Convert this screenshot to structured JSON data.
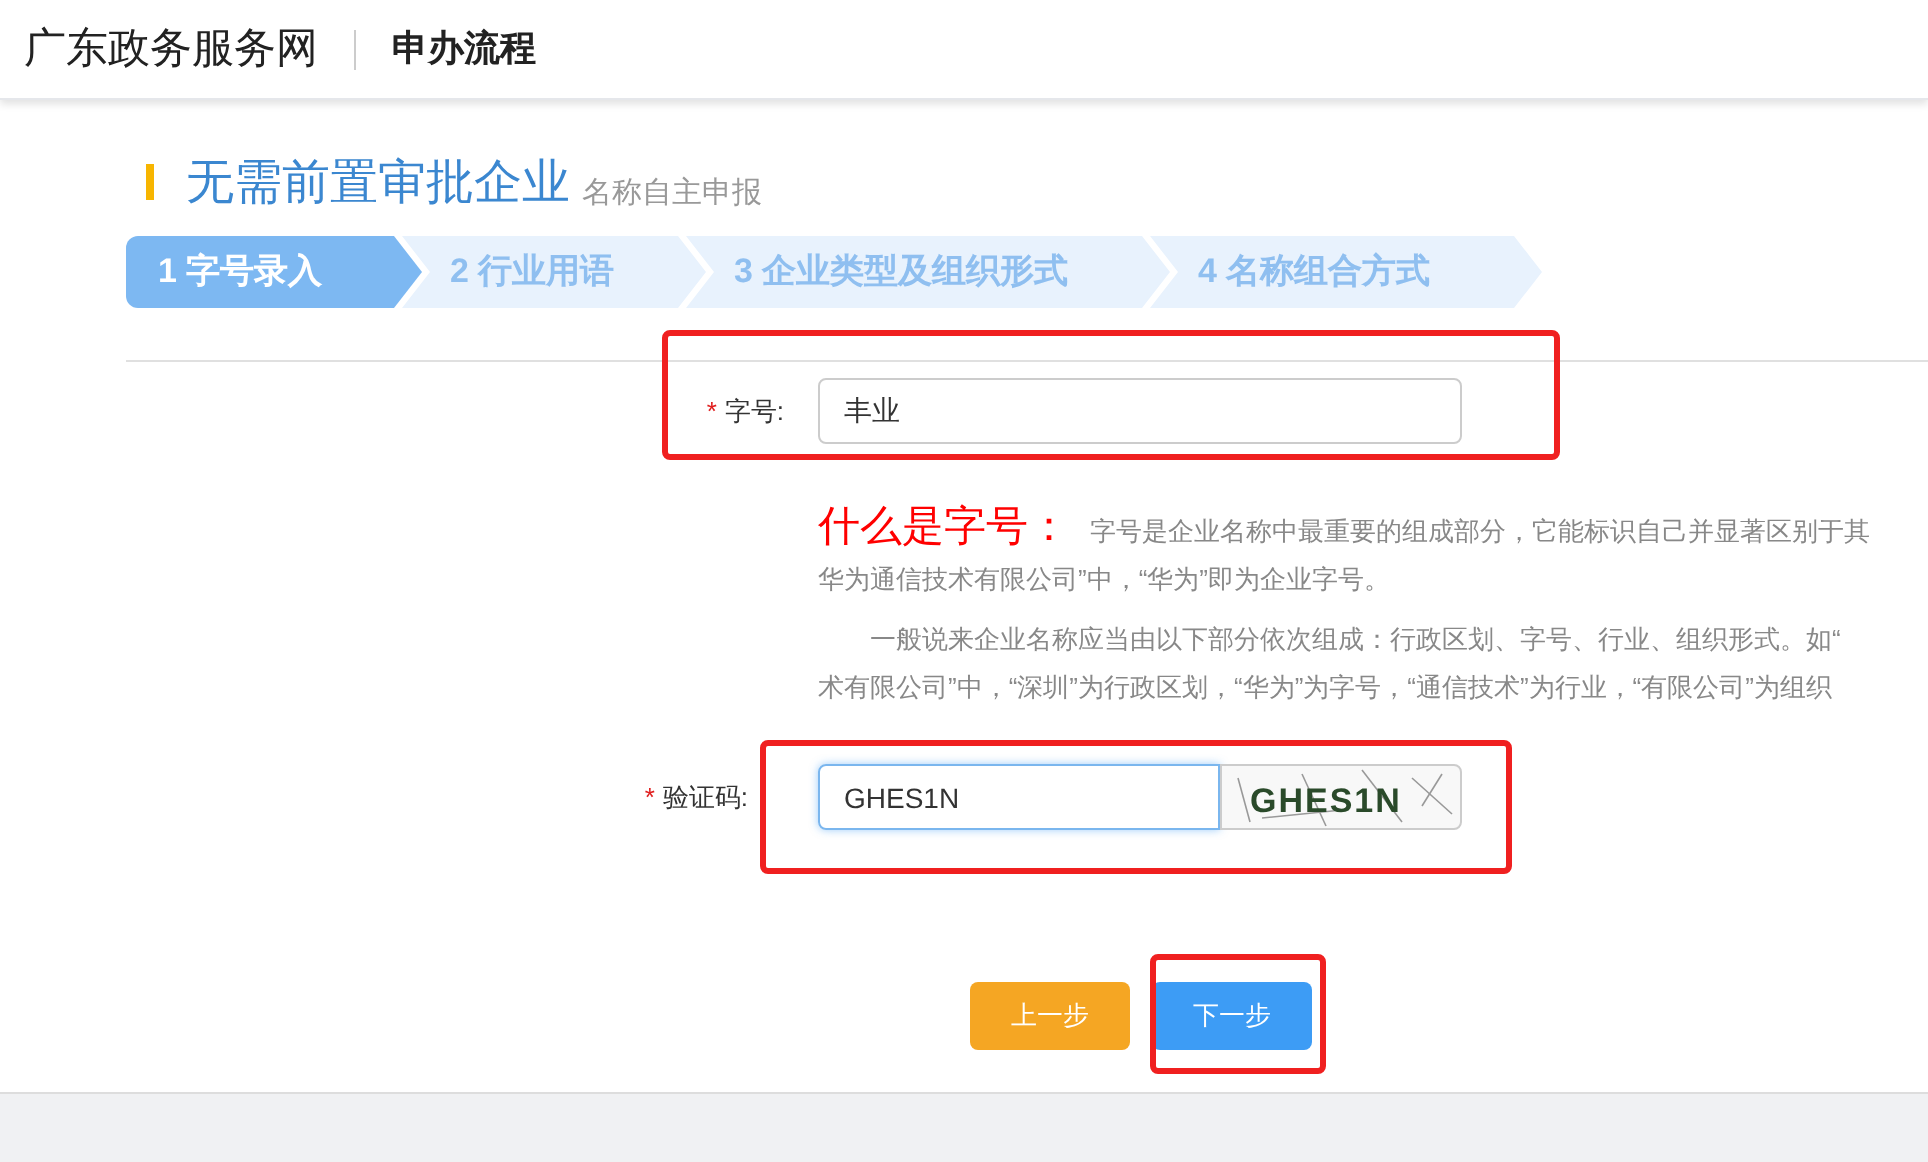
{
  "header": {
    "site_title": "广东政务服务网",
    "section": "申办流程"
  },
  "page_title": {
    "main": "无需前置审批企业",
    "sub": "名称自主申报"
  },
  "steps": [
    {
      "label": "1 字号录入",
      "selected": true
    },
    {
      "label": "2 行业用语",
      "selected": false
    },
    {
      "label": "3 企业类型及组织形式",
      "selected": false
    },
    {
      "label": "4 名称组合方式",
      "selected": false
    }
  ],
  "name_field": {
    "required_mark": "*",
    "label": "字号:",
    "value": "丰业"
  },
  "help": {
    "heading": "什么是字号：",
    "lines": [
      "字号是企业名称中最重要的组成部分，它能标识自己并显著区别于其",
      "华为通信技术有限公司”中，“华为”即为企业字号。"
    ],
    "paragraph_lines": [
      "一般说来企业名称应当由以下部分依次组成：行政区划、字号、行业、组织形式。如“",
      "术有限公司”中，“深圳”为行政区划，“华为”为字号，“通信技术”为行业，“有限公司”为组织"
    ]
  },
  "captcha_field": {
    "required_mark": "*",
    "label": "验证码:",
    "value": "GHES1N",
    "image_text": "GHES1N"
  },
  "buttons": [
    {
      "label": "上一步",
      "kind": "secondary"
    },
    {
      "label": "下一步",
      "kind": "primary"
    }
  ]
}
